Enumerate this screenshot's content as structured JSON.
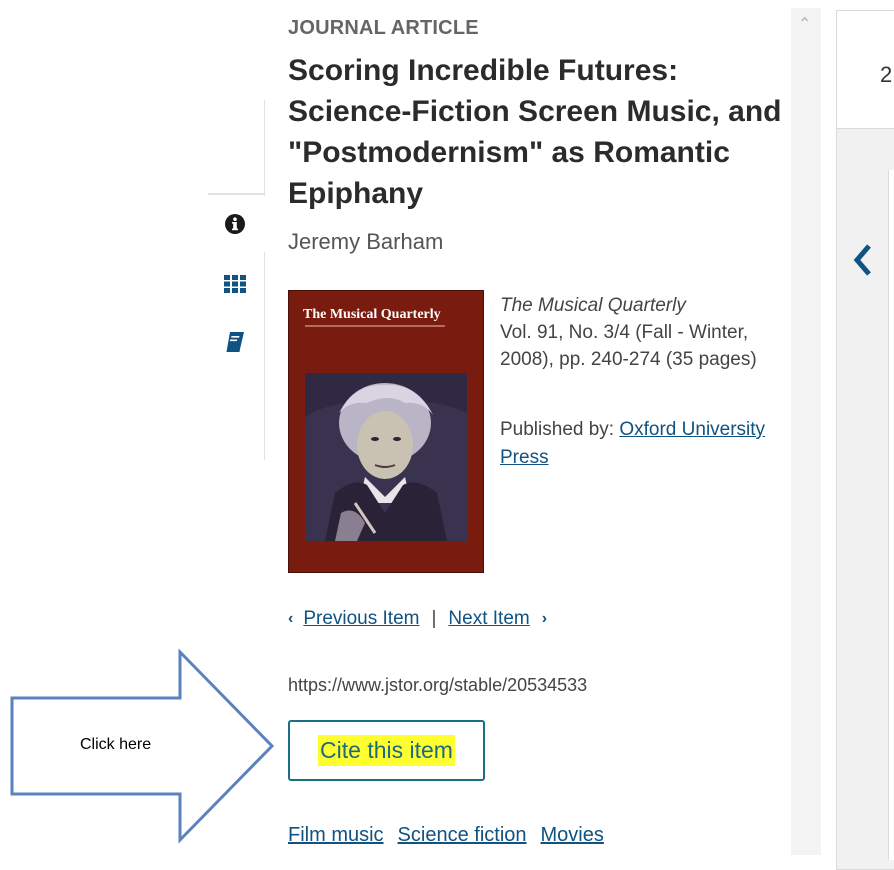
{
  "article": {
    "content_type": "JOURNAL ARTICLE",
    "title": "Scoring Incredible Futures: Science-Fiction Screen Music, and \"Postmodernism\" as Romantic Epiphany",
    "author": "Jeremy Barham"
  },
  "journal": {
    "cover_title": "The Musical Quarterly",
    "name": "The Musical Quarterly",
    "issue": "Vol. 91, No. 3/4 (Fall - Winter, 2008), pp. 240-274 (35 pages)",
    "published_by_label": "Published by:",
    "publisher": "Oxford University Press"
  },
  "navigation": {
    "previous_label": "Previous Item",
    "separator": "|",
    "next_label": "Next Item"
  },
  "stable_url": "https://www.jstor.org/stable/20534533",
  "cite_button": {
    "label": "Cite this item"
  },
  "subjects": [
    "Film music",
    "Science fiction",
    "Movies"
  ],
  "annotation": {
    "arrow_text": "Click here",
    "arrow_color": "#5b82bd"
  },
  "side_tabs": [
    "info-icon",
    "grid-icon",
    "book-icon"
  ],
  "viewer": {
    "page_number": "2"
  },
  "colors": {
    "link": "#105282",
    "highlight": "#ffff2f",
    "cover": "#7a1b0f"
  }
}
